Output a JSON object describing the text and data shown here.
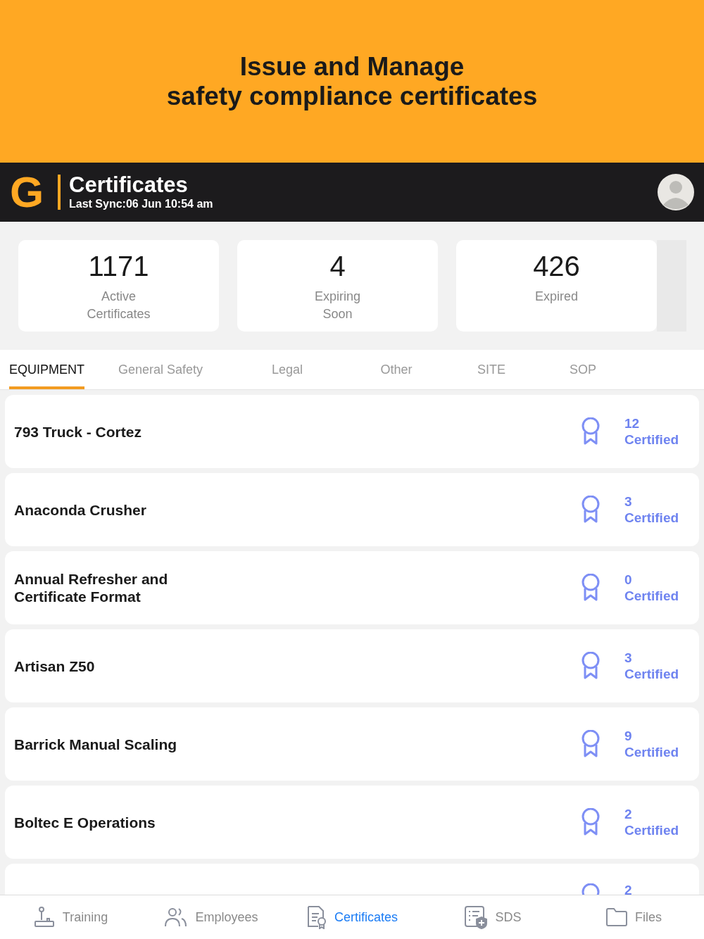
{
  "banner": {
    "headline_lines": [
      "Issue and Manage",
      "safety compliance certificates"
    ]
  },
  "header": {
    "logo": "G",
    "title": "Certificates",
    "subtitle": "Last Sync:06 Jun 10:54 am"
  },
  "stats": [
    {
      "value": "1171",
      "label_lines": [
        "Active",
        "Certificates"
      ]
    },
    {
      "value": "4",
      "label_lines": [
        "Expiring",
        "Soon"
      ]
    },
    {
      "value": "426",
      "label_lines": [
        "Expired"
      ]
    }
  ],
  "tabs": [
    {
      "label": "EQUIPMENT",
      "selected": true
    },
    {
      "label": "General Safety",
      "selected": false
    },
    {
      "label": "Legal",
      "selected": false
    },
    {
      "label": "Other",
      "selected": false
    },
    {
      "label": "SITE",
      "selected": false
    },
    {
      "label": "SOP",
      "selected": false
    }
  ],
  "rows": [
    {
      "kind": "full",
      "title_lines": [
        "793 Truck - Cortez"
      ],
      "count": "12",
      "count_label": "Certified"
    },
    {
      "kind": "full",
      "title_lines": [
        "Anaconda Crusher"
      ],
      "count": "3",
      "count_label": "Certified"
    },
    {
      "kind": "full",
      "title_lines": [
        "Annual Refresher and",
        "Certificate Format"
      ],
      "count": "0",
      "count_label": "Certified"
    },
    {
      "kind": "full",
      "title_lines": [
        "Artisan Z50"
      ],
      "count": "3",
      "count_label": "Certified"
    },
    {
      "kind": "full",
      "title_lines": [
        "Barrick Manual Scaling"
      ],
      "count": "9",
      "count_label": "Certified"
    },
    {
      "kind": "full",
      "title_lines": [
        "Boltec E Operations"
      ],
      "count": "2",
      "count_label": "Certified"
    },
    {
      "kind": "partial",
      "count": "2"
    }
  ],
  "nav": [
    {
      "kind": "training",
      "label": "Training",
      "selected": false
    },
    {
      "kind": "employees",
      "label": "Employees",
      "selected": false
    },
    {
      "kind": "certificates",
      "label": "Certificates",
      "selected": true
    },
    {
      "kind": "sds",
      "label": "SDS",
      "selected": false
    },
    {
      "kind": "files",
      "label": "Files",
      "selected": false
    }
  ]
}
